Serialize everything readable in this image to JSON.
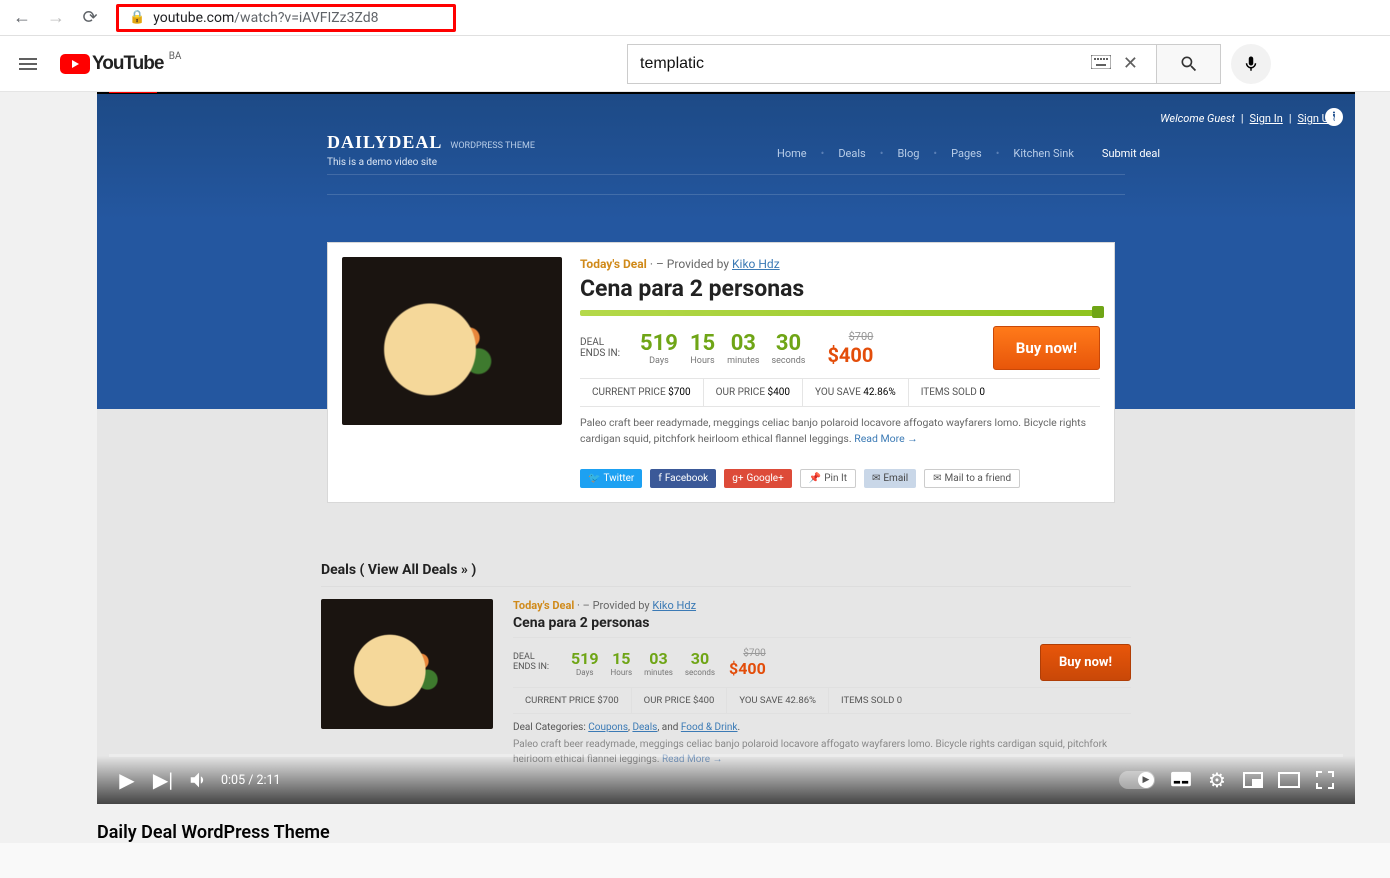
{
  "browser": {
    "url_domain": "youtube.com",
    "url_path": "/watch?v=iAVFIZz3Zd8"
  },
  "youtube": {
    "country": "BA",
    "logo_text": "YouTube",
    "search_value": "templatic",
    "mic_title": "Search with your voice"
  },
  "player": {
    "time_current": "0:05",
    "time_total": "2:11"
  },
  "video_title": "Daily Deal WordPress Theme",
  "site": {
    "brand_main": "DAILYDEAL",
    "brand_sub": "WORDPRESS THEME",
    "brand_tagline": "This is a demo video site",
    "welcome": "Welcome Guest",
    "sign_in": "Sign In",
    "sign_up": "Sign Up",
    "nav": [
      "Home",
      "Deals",
      "Blog",
      "Pages",
      "Kitchen Sink",
      "Submit deal"
    ]
  },
  "deal_main": {
    "today_label": "Today's Deal",
    "provided_text": " · – Provided by ",
    "provider": "Kiko Hdz",
    "title": "Cena para 2 personas",
    "deal_ends": "DEAL ENDS IN:",
    "countdown": [
      {
        "v": "519",
        "l": "Days"
      },
      {
        "v": "15",
        "l": "Hours"
      },
      {
        "v": "03",
        "l": "minutes"
      },
      {
        "v": "30",
        "l": "seconds"
      }
    ],
    "old_price": "$700",
    "new_price": "$400",
    "buy": "Buy now!",
    "stats": [
      {
        "k": "CURRENT PRICE",
        "v": "$700"
      },
      {
        "k": "OUR PRICE",
        "v": "$400"
      },
      {
        "k": "YOU SAVE",
        "v": "42.86%"
      },
      {
        "k": "ITEMS SOLD",
        "v": "0"
      }
    ],
    "desc": "Paleo craft beer readymade, meggings celiac banjo polaroid locavore affogato wayfarers lomo. Bicycle rights cardigan squid, pitchfork heirloom ethical flannel leggings. ",
    "readmore": "Read More →",
    "share": {
      "twitter": "Twitter",
      "facebook": "Facebook",
      "google": "Google+",
      "pinit": "Pin It",
      "email": "Email",
      "mail_friend": "Mail to a friend"
    }
  },
  "section2": {
    "heading": "Deals ( View All Deals » )",
    "today_label": "Today's Deal",
    "provided_text": " · – Provided by ",
    "provider": "Kiko Hdz",
    "title": "Cena para 2 personas",
    "deal_ends": "DEAL ENDS IN:",
    "countdown": [
      {
        "v": "519",
        "l": "Days"
      },
      {
        "v": "15",
        "l": "Hours"
      },
      {
        "v": "03",
        "l": "minutes"
      },
      {
        "v": "30",
        "l": "seconds"
      }
    ],
    "old_price": "$700",
    "new_price": "$400",
    "buy": "Buy now!",
    "stats": [
      {
        "k": "CURRENT PRICE",
        "v": "$700"
      },
      {
        "k": "OUR PRICE",
        "v": "$400"
      },
      {
        "k": "YOU SAVE",
        "v": "42.86%"
      },
      {
        "k": "ITEMS SOLD",
        "v": "0"
      }
    ],
    "cats_label": "Deal Categories: ",
    "cats": [
      "Coupons",
      "Deals",
      "Food & Drink"
    ],
    "cats_and": ", and ",
    "desc": "Paleo craft beer readymade, meggings celiac banjo polaroid locavore affogato wayfarers lomo. Bicycle rights cardigan squid, pitchfork heirloom ethical flannel leggings.",
    "readmore": "Read More →"
  }
}
